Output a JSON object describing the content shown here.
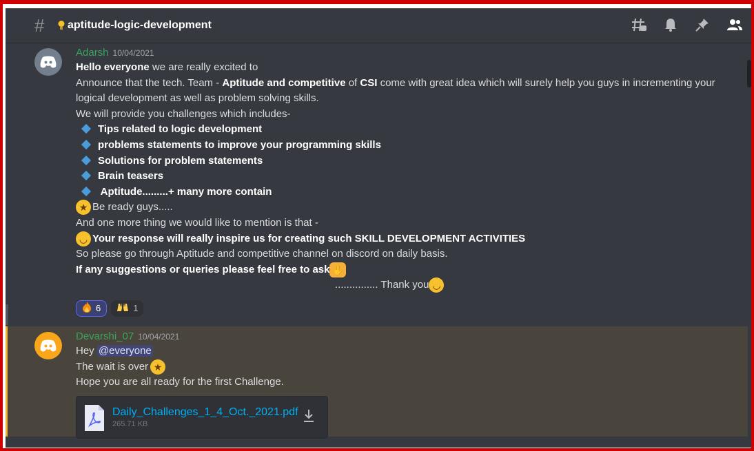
{
  "channel": {
    "name": "aptitude-logic-development"
  },
  "messages": {
    "m1": {
      "author": "Adarsh",
      "timestamp": "10/04/2021",
      "l1_bold": "Hello everyone",
      "l1_rest": " we are really excited to",
      "l2_a": "Announce that the tech. Team - ",
      "l2_b": "Aptitude and competitive",
      "l2_c": " of ",
      "l2_d": "CSI",
      "l2_e": " come with great idea which will surely help you guys in incrementing your logical development as well as problem solving skills.",
      "l3": "We will provide you challenges which includes-",
      "bullets": [
        "Tips related to logic development",
        "problems statements to improve your programming skills",
        "Solutions for problem statements",
        "Brain teasers",
        " Aptitude.........+ many more contain"
      ],
      "l4": "Be ready guys.....",
      "l5": "And one more thing we would like to mention is that -",
      "l6": "Your response will really inspire us for creating such SKILL DEVELOPMENT ACTIVITIES",
      "l7": "So please go through Aptitude and competitive channel on discord on daily basis.",
      "l8": "If any suggestions or queries please feel free to ask",
      "l9": "............... Thank you",
      "reactions": [
        {
          "emoji": "fire-emoji",
          "count": "6"
        },
        {
          "emoji": "raised-hands-emoji",
          "count": "1"
        }
      ]
    },
    "m2": {
      "author": "Devarshi_07",
      "timestamp": "10/04/2021",
      "l1": "Hey ",
      "mention": "@everyone",
      "l2": "The wait is over",
      "l3": "Hope you are all ready for the first Challenge.",
      "attachment": {
        "name": "Daily_Challenges_1_4_Oct._2021.pdf",
        "size": "265.71 KB"
      }
    }
  },
  "colors": {
    "accent": "#5865f2",
    "author": "#3ba55d",
    "mention_bg": "#414675",
    "highlight_bar": "#f0b232"
  },
  "icons": [
    "hash-icon",
    "bulb-icon",
    "threads-icon",
    "bell-icon",
    "pin-icon",
    "members-icon",
    "discord-avatar-icon",
    "pdf-icon",
    "download-icon"
  ]
}
